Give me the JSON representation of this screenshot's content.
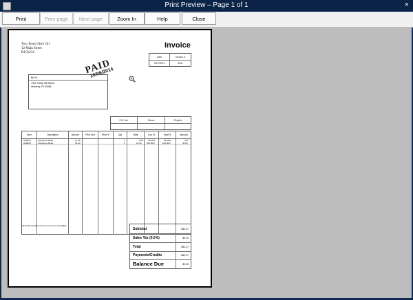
{
  "window": {
    "title": "Print Preview – Page 1 of 1",
    "close_glyph": "×"
  },
  "toolbar": {
    "print": "Print",
    "prev_page": "Prev page",
    "next_page": "Next page",
    "zoom_in": "Zoom In",
    "help": "Help",
    "close": "Close"
  },
  "invoice": {
    "company_name": "Two Trees Olive Oil",
    "company_street": "12 Main Street",
    "company_zip": "RI 01234",
    "title": "Invoice",
    "meta_headers": [
      "Date",
      "Invoice #"
    ],
    "meta_values": [
      "3/17/2014",
      "4001"
    ],
    "bill_to_label": "Bill To",
    "bill_to_lines": [
      "7321 Trinity Hill Street",
      "Westerly, RI 03948"
    ],
    "stamp_text": "PAID",
    "stamp_date": "10/06/2014",
    "po_headers": [
      "P.O. No.",
      "Terms",
      "Project"
    ],
    "item_headers": [
      "Item",
      "Description",
      "Bal Amt",
      "Prior Amt",
      "Prior %",
      "Qty",
      "Rate",
      "Curr %",
      "Total %",
      "Amount"
    ],
    "rows": [
      [
        "A1BF01",
        "Olivegrove Extra",
        "17.00",
        "",
        "",
        "2",
        "0.00",
        "50.00%",
        "50.00%",
        "4.67"
      ],
      [
        "A1BF04",
        "Olivegrove Beca",
        "46.00",
        "",
        "",
        "1",
        "22.00",
        "100.00%",
        "100.00%",
        "45.60"
      ]
    ],
    "footnote": "All finished bottles of olive oil are non-refundable.",
    "totals": [
      {
        "label": "Subtotal",
        "value": "$50.27"
      },
      {
        "label": "Sales Tax (0.0%)",
        "value": "$0.00"
      },
      {
        "label": "Total",
        "value": "$50.27"
      },
      {
        "label": "Payments/Credits",
        "value": "-$50.27"
      },
      {
        "label": "Balance Due",
        "value": "$0.00"
      }
    ]
  }
}
